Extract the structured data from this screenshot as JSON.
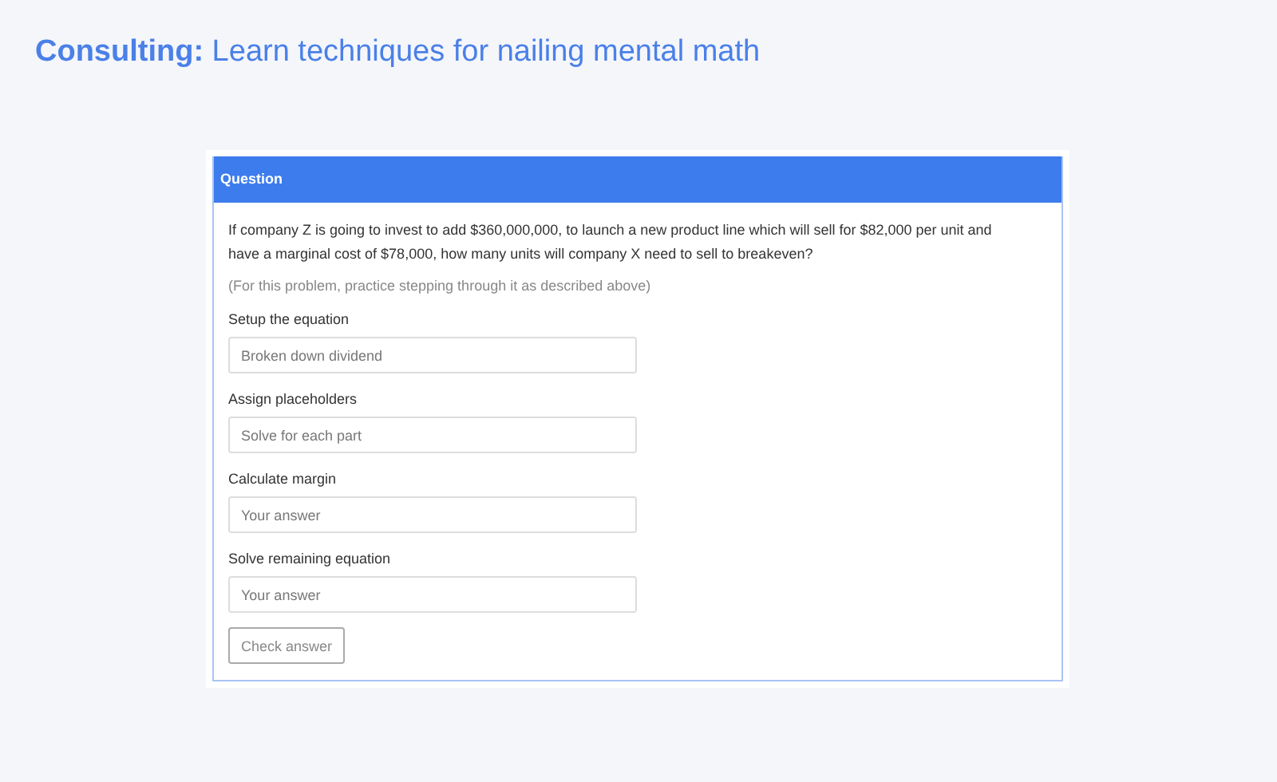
{
  "page_title": "**Consulting:** Learn techniques for nailing mental math",
  "panel": {
    "heading": "Question",
    "question": "If company Z is going to invest to add $360,000,000, to launch a new product line which will sell for $82,000 per unit and have a marginal cost of $78,000, how many units will company X need to sell to breakeven?",
    "note": "(For this problem, practice stepping through it as described above)",
    "steps": [
      {
        "label": "Setup the equation",
        "placeholder": "Broken down dividend"
      },
      {
        "label": "Assign placeholders",
        "placeholder": "Solve for each part"
      },
      {
        "label": "Calculate margin",
        "placeholder": "Your answer"
      },
      {
        "label": "Solve remaining equation",
        "placeholder": "Your answer"
      }
    ],
    "button": "Check answer"
  }
}
